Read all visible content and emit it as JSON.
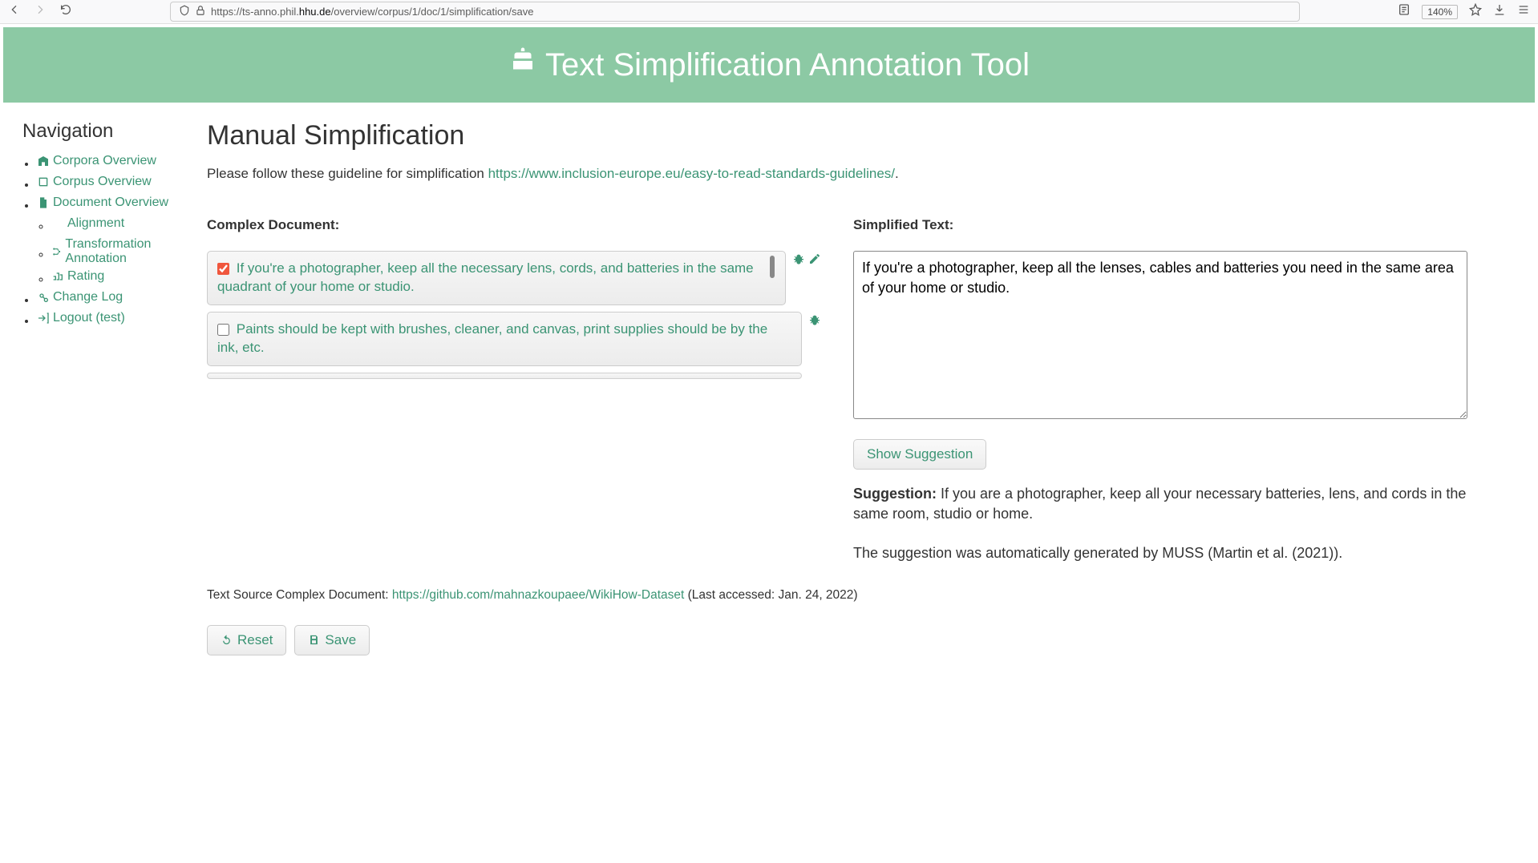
{
  "browser": {
    "url_prefix": "https://ts-anno.phil.",
    "url_domain": "hhu.de",
    "url_path": "/overview/corpus/1/doc/1/simplification/save",
    "zoom": "140%"
  },
  "banner": {
    "title": "Text Simplification Annotation Tool"
  },
  "nav": {
    "title": "Navigation",
    "items": {
      "corpora": "Corpora Overview",
      "corpus": "Corpus Overview",
      "document": "Document Overview",
      "alignment": "Alignment",
      "transformation": "Transformation Annotation",
      "rating": "Rating",
      "changelog": "Change Log",
      "logout": "Logout (test)"
    }
  },
  "page": {
    "title": "Manual Simplification",
    "guideline_prefix": "Please follow these guideline for simplification ",
    "guideline_link": "https://www.inclusion-europe.eu/easy-to-read-standards-guidelines/",
    "guideline_suffix": "."
  },
  "complex": {
    "label": "Complex Document:",
    "sentences": [
      {
        "checked": true,
        "text": "If you're a photographer, keep all the necessary lens, cords, and batteries in the same quadrant of your home or studio."
      },
      {
        "checked": false,
        "text": "Paints should be kept with brushes, cleaner, and canvas, print supplies should be by the ink, etc."
      }
    ]
  },
  "simplified": {
    "label": "Simplified Text:",
    "value": "If you're a photographer, keep all the lenses, cables and batteries you need in the same area of your home or studio.",
    "show_suggestion_btn": "Show Suggestion",
    "suggestion_label": "Suggestion:",
    "suggestion_text": " If you are a photographer, keep all your necessary batteries, lens, and cords in the same room, studio or home.",
    "attribution": "The suggestion was automatically generated by MUSS (Martin et al. (2021))."
  },
  "source": {
    "prefix": "Text Source Complex Document: ",
    "link": "https://github.com/mahnazkoupaee/WikiHow-Dataset",
    "suffix": " (Last accessed: Jan. 24, 2022)"
  },
  "actions": {
    "reset": "Reset",
    "save": "Save"
  }
}
